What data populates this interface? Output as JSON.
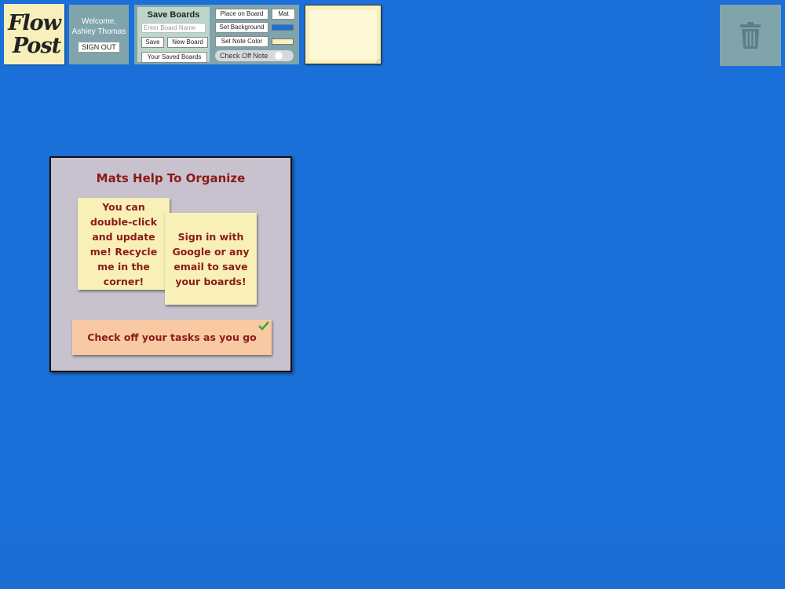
{
  "app": {
    "logo_line1": "Flow",
    "logo_line2": "Post"
  },
  "user": {
    "welcome_line": "Welcome,",
    "name": "Ashley Thomas",
    "sign_out_label": "SIGN OUT"
  },
  "save_boards": {
    "title": "Save Boards",
    "input_placeholder": "Enter Board Name",
    "input_value": "",
    "save_label": "Save",
    "new_board_label": "New Board",
    "saved_boards_label": "Your Saved Boards"
  },
  "board_controls": {
    "place_on_board_label": "Place on Board",
    "mat_label": "Mat",
    "set_background_label": "Set Background",
    "background_color": "#1a70d8",
    "set_note_color_label": "Set Note Color",
    "note_color": "#f8efbb",
    "check_off_note_label": "Check Off Note",
    "check_off_enabled": false
  },
  "icons": {
    "trash": "trash-can-icon",
    "check": "check-mark-icon"
  },
  "mat": {
    "title": "Mats Help To Organize",
    "notes": [
      {
        "text": "You can double-click and update me! Recycle me in the corner!",
        "color": "#f8f0b6"
      },
      {
        "text": "Sign in with Google or any email to save your boards!",
        "color": "#f8f0b6"
      },
      {
        "text": "Check off your tasks as you go",
        "color": "#f8c9a2",
        "checked": true
      }
    ]
  },
  "colors": {
    "board_background": "#1a70d8",
    "panel": "#80a4ab",
    "note_text": "#8a1a17",
    "check": "#3aa53a"
  }
}
